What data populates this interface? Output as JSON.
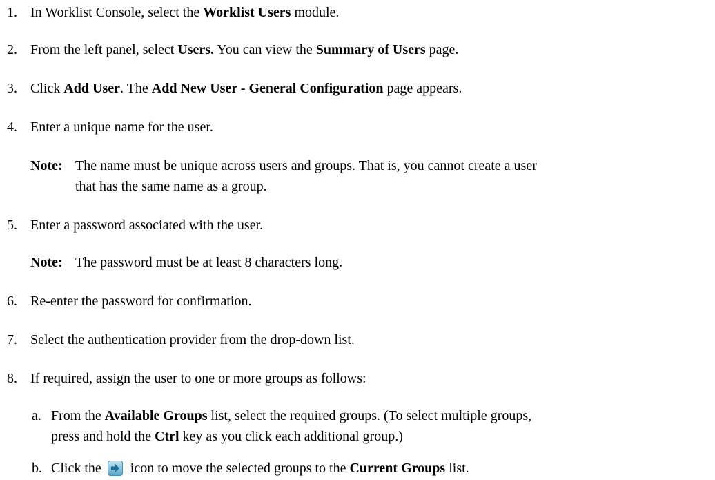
{
  "steps": [
    {
      "num": "1.",
      "parts": [
        "In Worklist Console, select the ",
        "Worklist Users",
        " module."
      ]
    },
    {
      "num": "2.",
      "parts": [
        "From the left panel, select ",
        "Users.",
        " You can view the ",
        "Summary of Users",
        " page."
      ]
    },
    {
      "num": "3.",
      "parts": [
        "Click ",
        "Add User",
        ". The ",
        "Add New User - General Configuration",
        " page appears."
      ]
    },
    {
      "num": "4.",
      "parts": [
        "Enter a unique name for the user."
      ]
    },
    {
      "num": "5.",
      "parts": [
        "Enter a password associated with the user."
      ]
    },
    {
      "num": "6.",
      "parts": [
        "Re-enter the password for confirmation."
      ]
    },
    {
      "num": "7.",
      "parts": [
        "Select the authentication provider from the drop-down list."
      ]
    },
    {
      "num": "8.",
      "parts": [
        "If required, assign the user to one or more groups as follows:"
      ]
    }
  ],
  "notes": {
    "label": "Note:",
    "name_note_line1": "The name must be unique across users and groups. That is, you cannot create a user",
    "name_note_line2": "that has the same name as a group.",
    "password_note": "The password must be at least 8 characters long."
  },
  "substeps": {
    "a": {
      "num": "a.",
      "line1_parts": [
        "From the ",
        "Available Groups",
        " list, select the required groups. (To select multiple groups,"
      ],
      "line2_parts": [
        "press and hold the ",
        "Ctrl",
        " key as you click each additional group.)"
      ]
    },
    "b": {
      "num": "b.",
      "parts_before_icon": [
        "Click the "
      ],
      "icon": "move-right-arrow-icon",
      "parts_after_icon": [
        " icon to move the selected groups to the ",
        "Current Groups",
        " list."
      ]
    }
  },
  "colors": {
    "icon_bg": "#6fb7d6",
    "icon_arrow": "#1f6e9a"
  }
}
